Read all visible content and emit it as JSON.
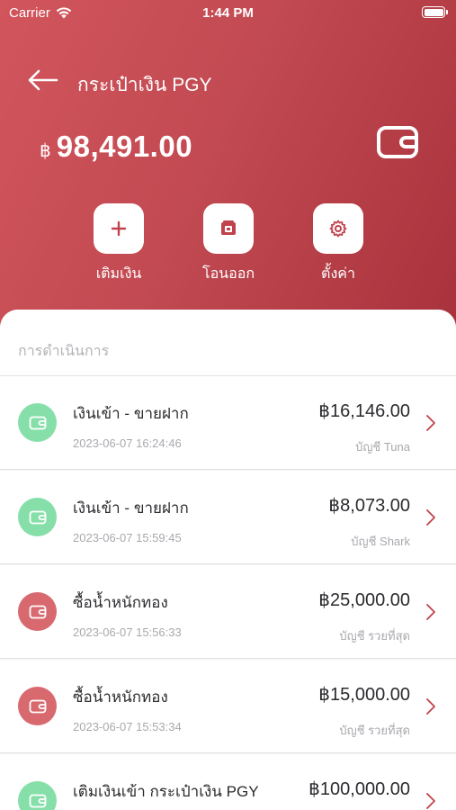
{
  "status_bar": {
    "carrier": "Carrier",
    "time": "1:44 PM"
  },
  "header": {
    "title": "กระเป๋าเงิน PGY",
    "currency_symbol": "฿",
    "balance": "98,491.00"
  },
  "actions": [
    {
      "label": "เติมเงิน",
      "icon": "plus-icon"
    },
    {
      "label": "โอนออก",
      "icon": "transfer-out-icon"
    },
    {
      "label": "ตั้งค่า",
      "icon": "gear-icon"
    }
  ],
  "section_title": "การดำเนินการ",
  "transactions": [
    {
      "title": "เงินเข้า - ขายฝาก",
      "date": "2023-06-07 16:24:46",
      "amount": "฿16,146.00",
      "account": "บัญชี Tuna",
      "type": "in",
      "color": "#86dfa9"
    },
    {
      "title": "เงินเข้า - ขายฝาก",
      "date": "2023-06-07 15:59:45",
      "amount": "฿8,073.00",
      "account": "บัญชี Shark",
      "type": "in",
      "color": "#86dfa9"
    },
    {
      "title": "ซื้อน้ำหนักทอง",
      "date": "2023-06-07 15:56:33",
      "amount": "฿25,000.00",
      "account": "บัญชี รวยที่สุด",
      "type": "out",
      "color": "#d8696f"
    },
    {
      "title": "ซื้อน้ำหนักทอง",
      "date": "2023-06-07 15:53:34",
      "amount": "฿15,000.00",
      "account": "บัญชี รวยที่สุด",
      "type": "out",
      "color": "#d8696f"
    },
    {
      "title": "เติมเงินเข้า กระเป๋าเงิน PGY",
      "date": "",
      "amount": "฿100,000.00",
      "account": "",
      "type": "in",
      "color": "#86dfa9"
    }
  ],
  "colors": {
    "accent": "#c0424c",
    "income": "#86dfa9",
    "expense": "#d8696f"
  }
}
